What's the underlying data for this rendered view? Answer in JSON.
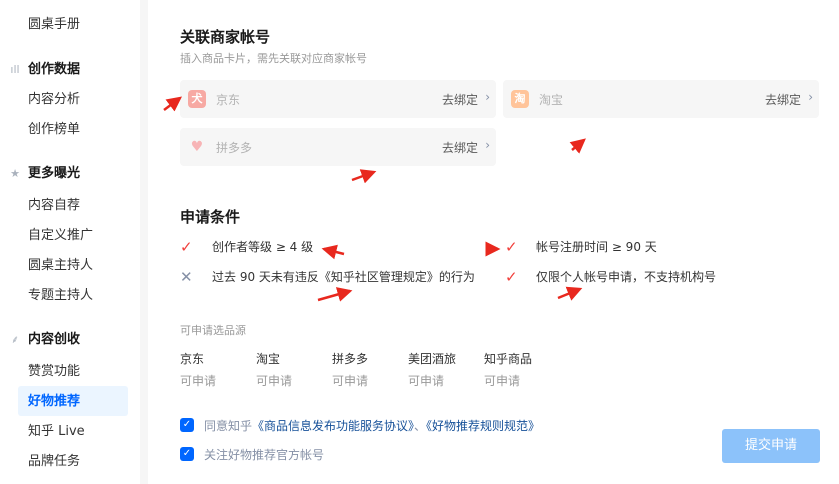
{
  "sidebar": {
    "item_top": "圆桌手册",
    "group_data": {
      "label": "创作数据",
      "icon": "bar-chart-icon"
    },
    "data_items": [
      "内容分析",
      "创作榜单"
    ],
    "group_exposure": {
      "label": "更多曝光",
      "icon": "star-icon"
    },
    "exposure_items": [
      "内容自荐",
      "自定义推广",
      "圆桌主持人",
      "专题主持人"
    ],
    "group_monetize": {
      "label": "内容创收",
      "icon": "leaf-icon"
    },
    "monetize_items": [
      "赞赏功能",
      "好物推荐",
      "知乎 Live",
      "品牌任务"
    ]
  },
  "main": {
    "title": "关联商家帐号",
    "subtitle": "插入商品卡片，需先关联对应商家帐号",
    "accounts": [
      {
        "name": "京东",
        "action": "去绑定",
        "icon_color": "#f7a9a3",
        "icon": "jd-icon"
      },
      {
        "name": "淘宝",
        "action": "去绑定",
        "icon_color": "#ffc49a",
        "icon": "taobao-icon"
      },
      {
        "name": "拼多多",
        "action": "去绑定",
        "icon_color": "#f7b4b6",
        "icon": "pdd-icon"
      }
    ],
    "conditions_title": "申请条件",
    "conditions": [
      {
        "text": "创作者等级 ≥ 4 级",
        "met": true
      },
      {
        "text": "帐号注册时间 ≥ 90 天",
        "met": true
      },
      {
        "text": "过去 90 天未有违反《知乎社区管理规定》的行为",
        "met": false
      },
      {
        "text": "仅限个人帐号申请，不支持机构号",
        "met": true
      }
    ],
    "sources_title": "可申请选品源",
    "sources": [
      {
        "name": "京东",
        "status": "可申请"
      },
      {
        "name": "淘宝",
        "status": "可申请"
      },
      {
        "name": "拼多多",
        "status": "可申请"
      },
      {
        "name": "美团酒旅",
        "status": "可申请"
      },
      {
        "name": "知乎商品",
        "status": "可申请"
      }
    ],
    "agree_prefix": "同意知乎",
    "agree_link1": "《商品信息发布功能服务协议》",
    "agree_sep": "、",
    "agree_link2": "《好物推荐规则规范》",
    "follow_label": "关注好物推荐官方帐号",
    "submit_label": "提交申请"
  },
  "colors": {
    "accent": "#0066ff",
    "check": "#f1403c",
    "submit_disabled": "#8cc2fa",
    "annotation": "#e8281e"
  }
}
